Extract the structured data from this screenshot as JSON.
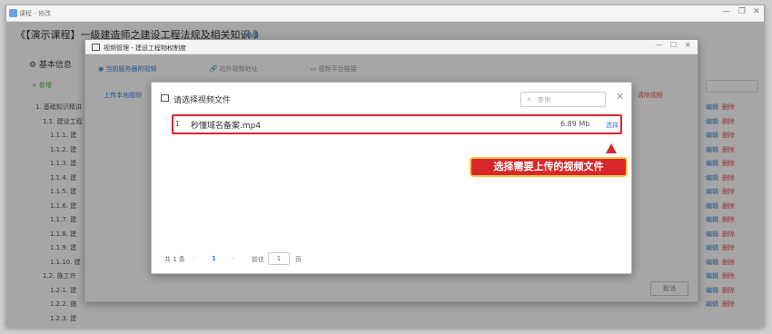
{
  "window": {
    "title": "课程 - 修改"
  },
  "course": {
    "title": "《【演示课程】一级建造师之建设工程法规及相关知识 》",
    "edit_label": "编辑"
  },
  "sidebar": {
    "basic_info": "基本信息",
    "new_label": "+ 新增"
  },
  "tree": [
    "1. 基础知识精讲",
    "1.1. 建设工程",
    "1.1.1. 建",
    "1.1.2. 建",
    "1.1.3. 建",
    "1.1.4. 建",
    "1.1.5. 建",
    "1.1.6. 建",
    "1.1.7. 建",
    "1.1.8. 建",
    "1.1.9. 建",
    "1.1.10. 建",
    "1.2. 施工许",
    "1.2.1. 建",
    "1.2.2. 施",
    "1.2.3. 建"
  ],
  "row_actions": {
    "edit": "编辑",
    "delete": "删除"
  },
  "video_manager": {
    "title": "视频管理 - 建设工程物权制度",
    "tabs": [
      "当前服务器的视频",
      "站外视频地址",
      "视频平台链接"
    ],
    "upload_label": "上传本地视频",
    "clear_label": "清除视频",
    "cancel_label": "取消"
  },
  "select_dialog": {
    "title": "请选择视频文件",
    "search_placeholder": "查询",
    "files": [
      {
        "index": "1",
        "name": "秒懂域名备案.mp4",
        "size": "6.89 Mb",
        "action": "选择"
      }
    ],
    "pager": {
      "total": "共 1 条",
      "prev": "‹",
      "current": "1",
      "next": "›",
      "goto_label": "前往",
      "goto_value": "1",
      "page_suffix": "页"
    }
  },
  "annotation": {
    "text": "选择需要上传的视频文件",
    "color": "#d9262a"
  }
}
